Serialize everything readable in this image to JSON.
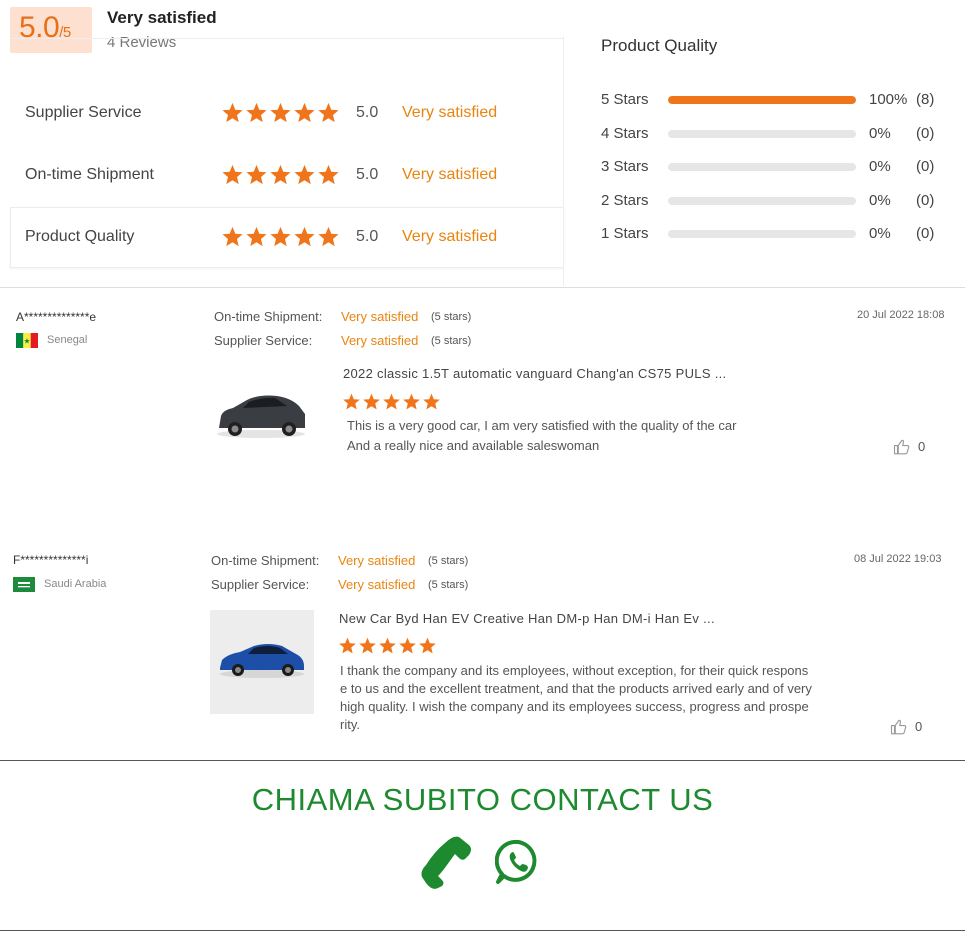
{
  "summary": {
    "score": "5.0",
    "score_max": "/5",
    "overall_label": "Very satisfied",
    "reviews_count": "4 Reviews",
    "ratings": [
      {
        "label": "Supplier Service",
        "value": "5.0",
        "text": "Very satisfied",
        "stars": 5
      },
      {
        "label": "On-time Shipment",
        "value": "5.0",
        "text": "Very satisfied",
        "stars": 5
      },
      {
        "label": "Product Quality",
        "value": "5.0",
        "text": "Very satisfied",
        "stars": 5
      }
    ]
  },
  "distribution": {
    "title": "Product Quality",
    "rows": [
      {
        "label": "5 Stars",
        "fraction": 1.0,
        "pct": "100%",
        "count": "(8)"
      },
      {
        "label": "4 Stars",
        "fraction": 0.0,
        "pct": "0%",
        "count": "(0)"
      },
      {
        "label": "3 Stars",
        "fraction": 0.0,
        "pct": "0%",
        "count": "(0)"
      },
      {
        "label": "2 Stars",
        "fraction": 0.0,
        "pct": "0%",
        "count": "(0)"
      },
      {
        "label": "1 Stars",
        "fraction": 0.0,
        "pct": "0%",
        "count": "(0)"
      }
    ]
  },
  "reviews": [
    {
      "reviewer": "A**************e",
      "country": "Senegal",
      "shipment_label": "On-time Shipment:",
      "shipment_value": "Very satisfied",
      "shipment_stars": "(5 stars)",
      "service_label": "Supplier Service:",
      "service_value": "Very satisfied",
      "service_stars": "(5 stars)",
      "date": "20 Jul 2022 18:08",
      "product_title": "2022 classic 1.5T automatic vanguard Chang'an CS75 PULS ...",
      "rating": 5,
      "text_lines": [
        "This is a very good car, I am very satisfied with the quality of the car",
        "And a really nice and available saleswoman"
      ],
      "likes": "0",
      "car_color": "#3a3d42"
    },
    {
      "reviewer": "F**************i",
      "country": "Saudi Arabia",
      "shipment_label": "On-time Shipment:",
      "shipment_value": "Very satisfied",
      "shipment_stars": "(5 stars)",
      "service_label": "Supplier Service:",
      "service_value": "Very satisfied",
      "service_stars": "(5 stars)",
      "date": "08 Jul 2022 19:03",
      "product_title": "New Car Byd Han EV Creative Han DM-p Han DM-i Han Ev ...",
      "rating": 5,
      "text_lines": [
        "I thank the company and its employees, without exception, for their quick respons",
        "e to us and the excellent treatment, and that the products arrived early and of very",
        "high quality.  I wish the company and its employees success, progress and prospe",
        "rity."
      ],
      "likes": "0",
      "car_color": "#1d4fa8"
    }
  ],
  "footer": {
    "cta_text": "CHIAMA SUBITO  CONTACT US",
    "icons": [
      "phone-icon",
      "whatsapp-icon"
    ]
  },
  "colors": {
    "accent": "#f07419",
    "satisfied": "#e8850f",
    "cta": "#1e8a2f"
  }
}
